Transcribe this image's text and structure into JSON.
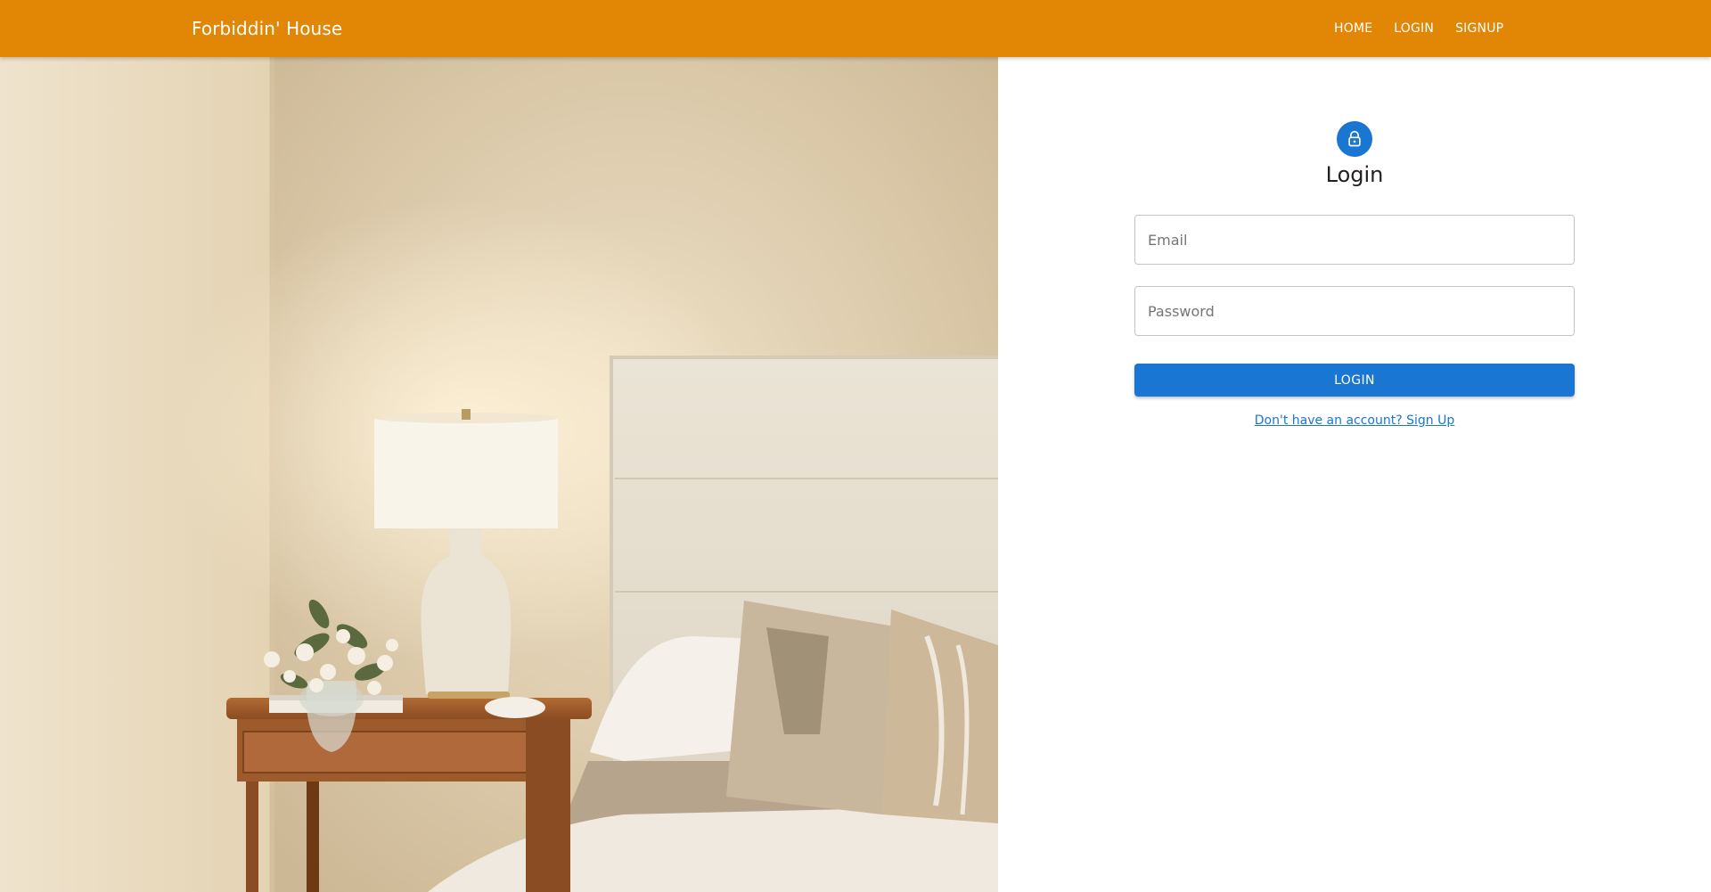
{
  "app": {
    "brand": "Forbiddin' House",
    "accent_color": "#e18605",
    "primary_color": "#1976d2"
  },
  "nav": {
    "items": [
      {
        "label": "HOME"
      },
      {
        "label": "LOGIN"
      },
      {
        "label": "SIGNUP"
      }
    ]
  },
  "hero": {
    "image": "bedroom-interior-photo"
  },
  "login": {
    "icon": "lock-icon",
    "title": "Login",
    "email_placeholder": "Email",
    "password_placeholder": "Password",
    "submit_label": "LOGIN",
    "signup_link": "Don't have an account? Sign Up"
  }
}
